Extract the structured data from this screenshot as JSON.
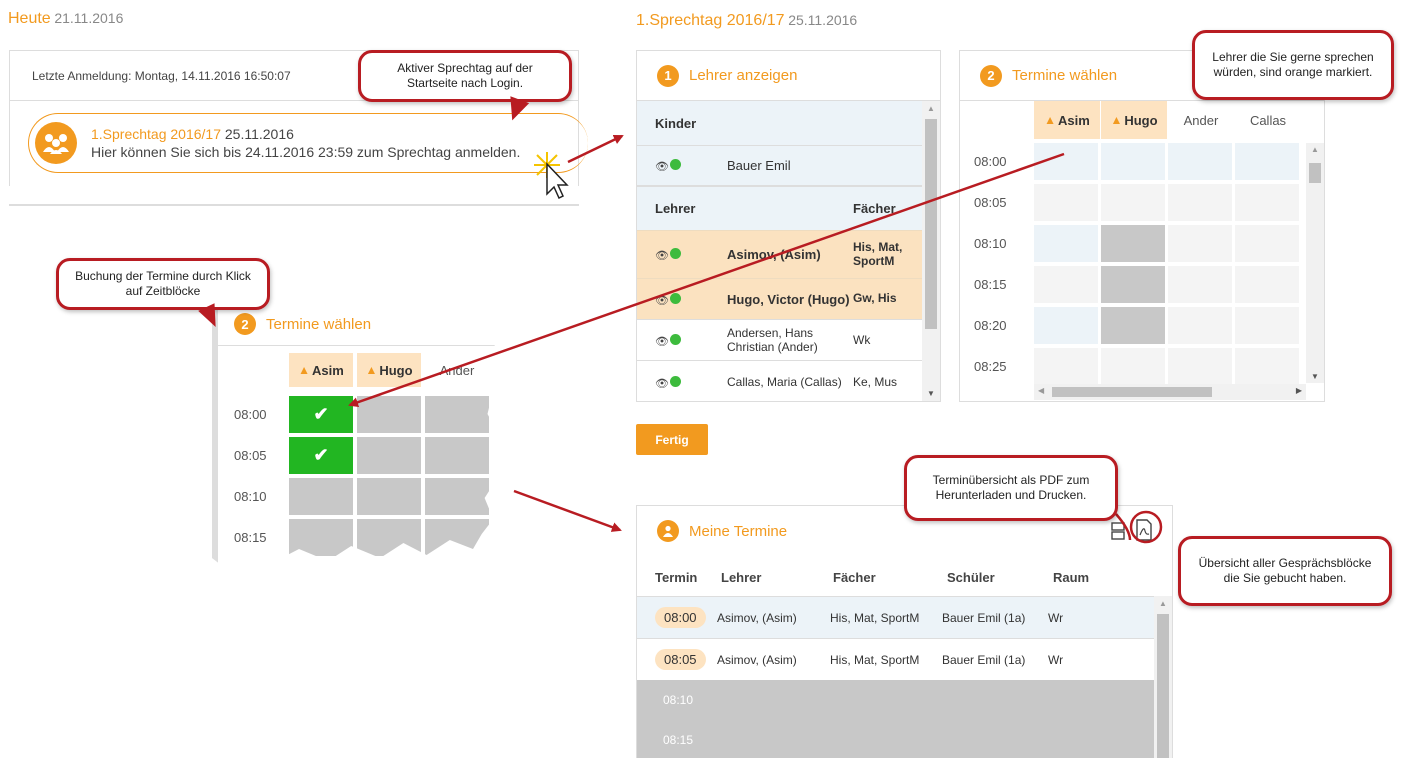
{
  "today": {
    "label": "Heute",
    "date": "21.11.2016"
  },
  "sprechtag_header": {
    "title": "1.Sprechtag 2016/17",
    "date": "25.11.2016"
  },
  "login_panel": {
    "last_login": "Letzte Anmeldung: Montag, 14.11.2016 16:50:07",
    "event_title": "1.Sprechtag 2016/17",
    "event_date": "25.11.2016",
    "event_text": "Hier können Sie sich bis 24.11.2016 23:59 zum Sprechtag anmelden."
  },
  "callouts": {
    "aktiver": "Aktiver Sprechtag auf der Startseite nach Login.",
    "lehrer_markiert": "Lehrer die Sie gerne sprechen würden, sind orange markiert.",
    "buchung": "Buchung der Termine durch Klick auf Zeitblöcke",
    "pdf": "Terminübersicht als PDF zum Herunterladen und Drucken.",
    "uebersicht": "Übersicht aller Gesprächsblöcke die Sie gebucht haben."
  },
  "lehrer_panel": {
    "badge": "1",
    "title": "Lehrer anzeigen",
    "kinder_header": "Kinder",
    "kinder": [
      {
        "name": "Bauer Emil"
      }
    ],
    "lehrer_header": "Lehrer",
    "faecher_header": "Fächer",
    "lehrer": [
      {
        "name": "Asimov, (Asim)",
        "faecher": "His, Mat, SportM",
        "marked": true
      },
      {
        "name": "Hugo, Victor (Hugo)",
        "faecher": "Gw, His",
        "marked": true
      },
      {
        "name": "Andersen, Hans Christian (Ander)",
        "faecher": "Wk",
        "marked": false
      },
      {
        "name": "Callas, Maria (Callas)",
        "faecher": "Ke, Mus",
        "marked": false
      }
    ]
  },
  "termine_panel": {
    "badge": "2",
    "title": "Termine wählen",
    "columns": [
      "Asim",
      "Hugo",
      "Ander",
      "Callas"
    ],
    "times": [
      "08:00",
      "08:05",
      "08:10",
      "08:15",
      "08:20",
      "08:25"
    ]
  },
  "zoom_panel": {
    "badge": "2",
    "title": "Termine wählen",
    "columns": [
      "Asim",
      "Hugo",
      "Ander"
    ],
    "times": [
      "08:00",
      "08:05",
      "08:10",
      "08:15"
    ]
  },
  "fertig_button": "Fertig",
  "meine_termine": {
    "title": "Meine Termine",
    "headers": [
      "Termin",
      "Lehrer",
      "Fächer",
      "Schüler",
      "Raum"
    ],
    "rows": [
      {
        "termin": "08:00",
        "lehrer": "Asimov, (Asim)",
        "faecher": "His, Mat, SportM",
        "schueler": "Bauer Emil (1a)",
        "raum": "Wr"
      },
      {
        "termin": "08:05",
        "lehrer": "Asimov, (Asim)",
        "faecher": "His, Mat, SportM",
        "schueler": "Bauer Emil (1a)",
        "raum": "Wr"
      }
    ],
    "empty_times": [
      "08:10",
      "08:15"
    ]
  },
  "colors": {
    "accent": "#f29a1f",
    "callout_border": "#b81c22",
    "booked": "#22b622",
    "blocked": "#c8c8c8",
    "selected_row": "#fbe2c0"
  }
}
